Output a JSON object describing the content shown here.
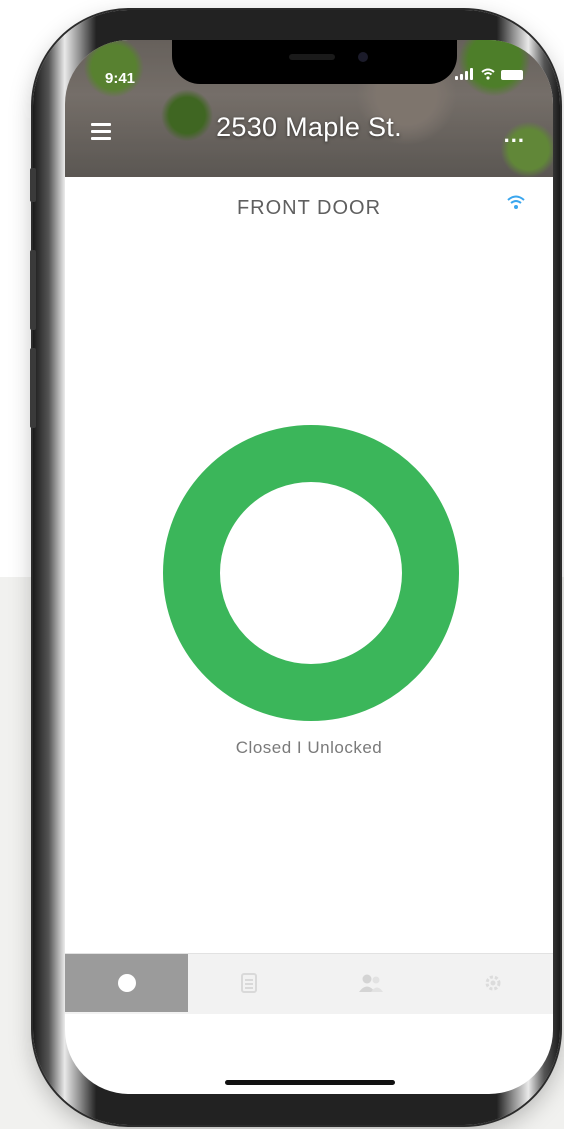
{
  "status_bar": {
    "time": "9:41"
  },
  "header": {
    "title": "2530 Maple St.",
    "menu_icon": "hamburger-menu-icon",
    "more_icon": "more-dots-icon",
    "more_label": "..."
  },
  "door": {
    "name": "FRONT DOOR",
    "connection_icon": "wifi-icon",
    "status": "Closed I Unlocked",
    "ring_color": "#3bb65a"
  },
  "tabs": [
    {
      "icon": "lock-circle-icon",
      "active": true
    },
    {
      "icon": "history-list-icon",
      "active": false
    },
    {
      "icon": "users-icon",
      "active": false
    },
    {
      "icon": "settings-gear-icon",
      "active": false
    }
  ],
  "colors": {
    "accent_green": "#3bb65a",
    "wifi_blue": "#3aa6ee",
    "active_tab": "#9b9b9b"
  }
}
